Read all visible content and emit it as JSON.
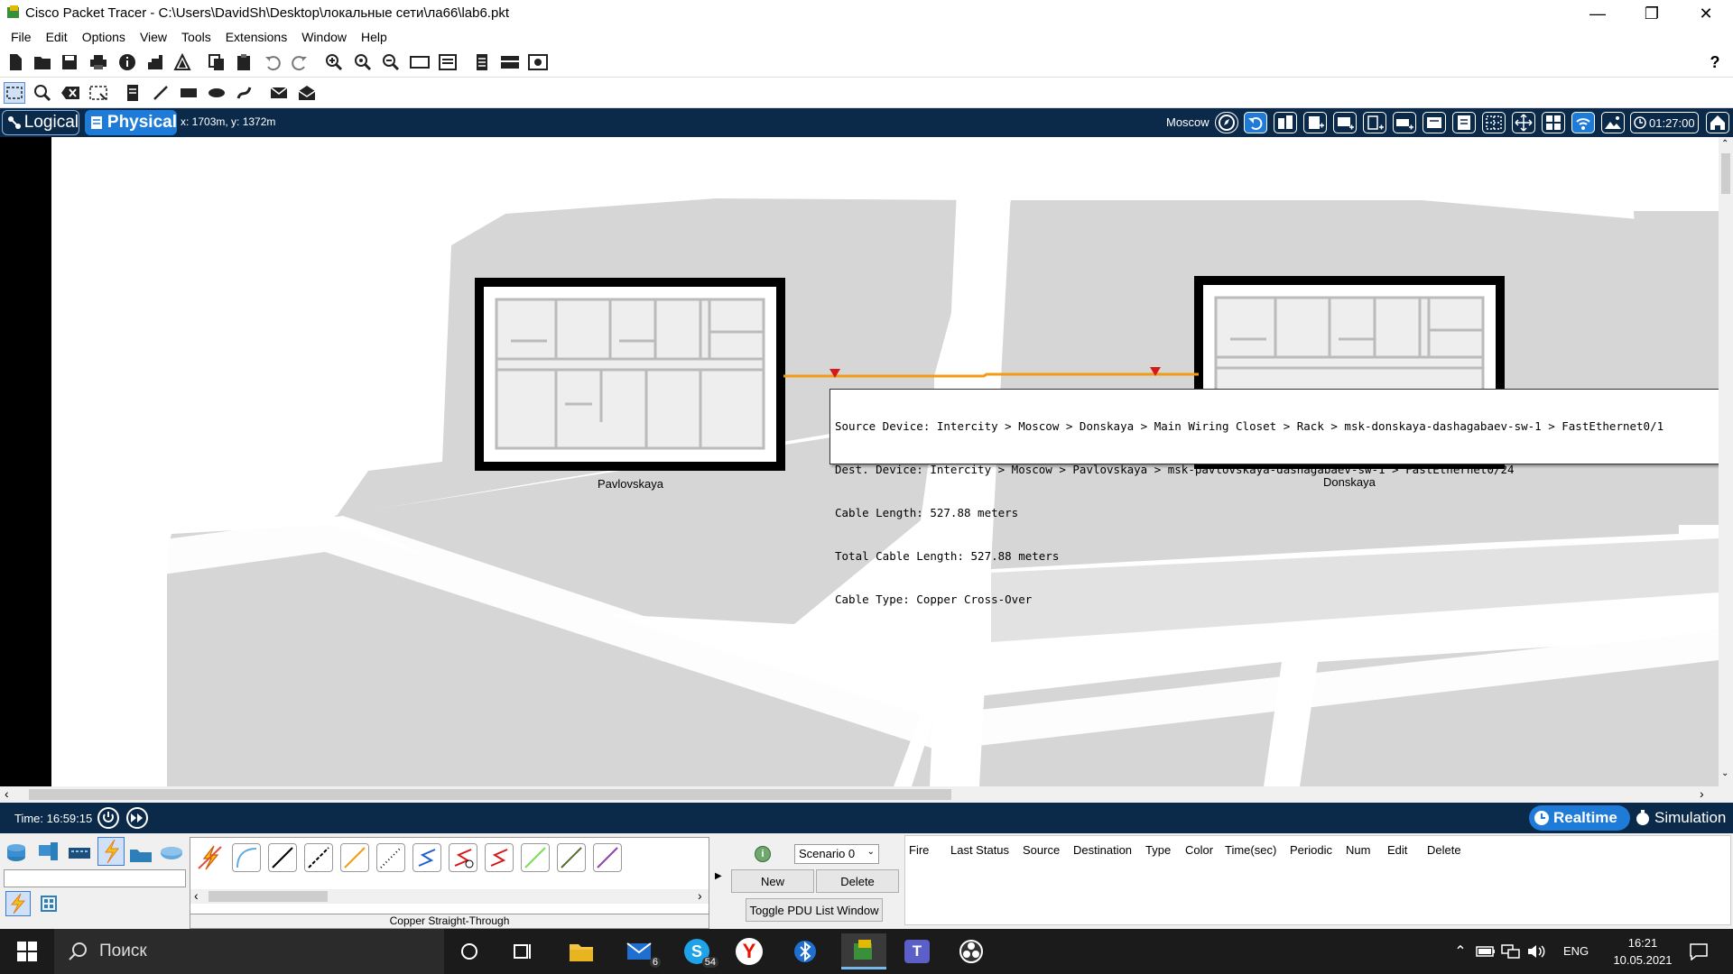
{
  "window": {
    "title": "Cisco Packet Tracer - C:\\Users\\DavidSh\\Desktop\\локальные сети\\ла66\\lab6.pkt"
  },
  "menu": [
    "File",
    "Edit",
    "Options",
    "View",
    "Tools",
    "Extensions",
    "Window",
    "Help"
  ],
  "nav": {
    "logical_label": "Logical",
    "physical_label": "Physical",
    "coords": "x: 1703m, y: 1372m",
    "city": "Moscow",
    "clock": "01:27:00"
  },
  "workspace": {
    "buildings": [
      {
        "name": "Pavlovskaya"
      },
      {
        "name": "Donskaya"
      }
    ],
    "tooltip": {
      "source": "Source Device: Intercity > Moscow > Donskaya > Main Wiring Closet > Rack > msk-donskaya-dashagabaev-sw-1 > FastEthernet0/1",
      "dest": "Dest. Device: Intercity > Moscow > Pavlovskaya > msk-pavlovskaya-dashagabaev-sw-1 > FastEthernet0/24",
      "cable_length": "Cable Length: 527.88 meters",
      "total_length": "Total Cable Length: 527.88 meters",
      "cable_type": "Cable Type: Copper Cross-Over"
    },
    "link_color": "#f39c12"
  },
  "timebar": {
    "time": "Time: 16:59:15",
    "realtime_label": "Realtime",
    "simulation_label": "Simulation"
  },
  "bottom": {
    "selected_cable": "Copper Straight-Through",
    "scenario": "Scenario 0",
    "new_label": "New",
    "delete_label": "Delete",
    "toggle_pdu_label": "Toggle PDU List Window",
    "pdu_columns": [
      "Fire",
      "Last Status",
      "Source",
      "Destination",
      "Type",
      "Color",
      "Time(sec)",
      "Periodic",
      "Num",
      "Edit",
      "Delete"
    ]
  },
  "taskbar": {
    "search_placeholder": "Поиск",
    "mail_badge": "6",
    "skype_badge": "54",
    "lang": "ENG",
    "time": "16:21",
    "date": "10.05.2021"
  }
}
